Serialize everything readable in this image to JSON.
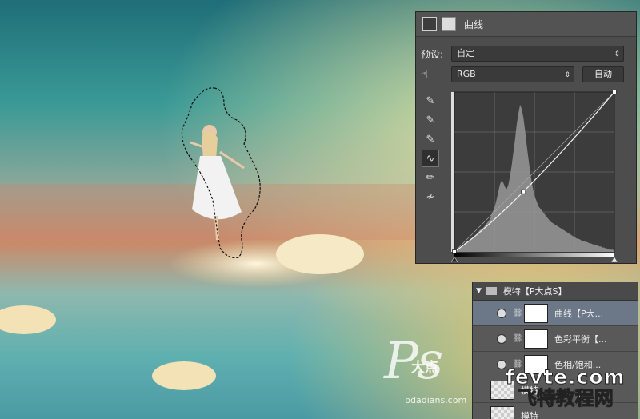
{
  "curves_panel": {
    "title": "曲线",
    "preset_label": "预设:",
    "preset_value": "自定",
    "channel_value": "RGB",
    "auto_button": "自动",
    "histogram": [
      2,
      2,
      3,
      4,
      5,
      6,
      8,
      9,
      10,
      11,
      12,
      13,
      14,
      16,
      18,
      20,
      21,
      22,
      24,
      26,
      28,
      30,
      34,
      38,
      42,
      48,
      55,
      62,
      66,
      64,
      60,
      58,
      62,
      70,
      80,
      92,
      104,
      118,
      128,
      136,
      132,
      124,
      112,
      98,
      86,
      74,
      64,
      56,
      50,
      46,
      42,
      40,
      38,
      36,
      34,
      32,
      30,
      28,
      27,
      26,
      25,
      24,
      23,
      22,
      21,
      20,
      19,
      18,
      17,
      16,
      15,
      14,
      13,
      12,
      12,
      11,
      10,
      10,
      9,
      9,
      8,
      8,
      7,
      7,
      6,
      6,
      5,
      5,
      4,
      4,
      3,
      3,
      2,
      2,
      2,
      1
    ],
    "curve_points": [
      [
        0,
        0
      ],
      [
        110,
        96
      ],
      [
        255,
        255
      ]
    ]
  },
  "layers_panel": {
    "group_name": "模特【P大点S】",
    "layers": [
      {
        "name": "曲线【P大...",
        "type": "adjust"
      },
      {
        "name": "色彩平衡【...",
        "type": "adjust"
      },
      {
        "name": "色相/饱和...",
        "type": "adjust"
      },
      {
        "name": "模特...",
        "type": "pixel"
      },
      {
        "name": "模特",
        "type": "pixel"
      }
    ]
  },
  "watermarks": {
    "logo_ps": "Ps",
    "logo_cn": "大点",
    "logo_url": "pdadians.com",
    "site_domain": "fevte.com",
    "site_name": "飞特教程网"
  }
}
